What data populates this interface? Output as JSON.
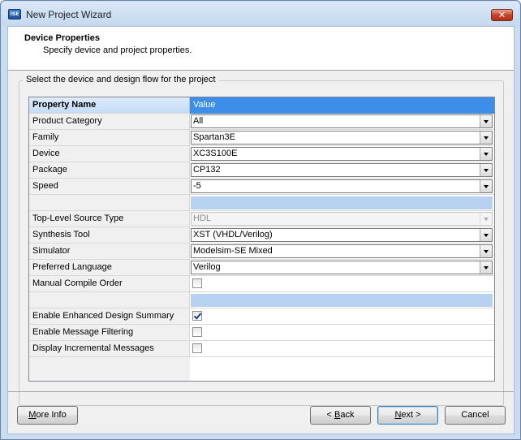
{
  "window": {
    "title": "New Project Wizard",
    "icon": "ise-app-icon",
    "icon_text": "ISE",
    "close_glyph": "✕"
  },
  "header": {
    "title": "Device Properties",
    "subtitle": "Specify device and project properties."
  },
  "group": {
    "caption": "Select the device and design flow for the project"
  },
  "grid": {
    "col_name": "Property Name",
    "col_value": "Value",
    "rows": [
      {
        "name": "Product Category",
        "value": "All",
        "type": "combo"
      },
      {
        "name": "Family",
        "value": "Spartan3E",
        "type": "combo"
      },
      {
        "name": "Device",
        "value": "XC3S100E",
        "type": "combo"
      },
      {
        "name": "Package",
        "value": "CP132",
        "type": "combo"
      },
      {
        "name": "Speed",
        "value": "-5",
        "type": "combo"
      },
      {
        "name": "",
        "value": "",
        "type": "separator"
      },
      {
        "name": "Top-Level Source Type",
        "value": "HDL",
        "type": "combo-disabled"
      },
      {
        "name": "Synthesis Tool",
        "value": "XST (VHDL/Verilog)",
        "type": "combo"
      },
      {
        "name": "Simulator",
        "value": "Modelsim-SE Mixed",
        "type": "combo"
      },
      {
        "name": "Preferred Language",
        "value": "Verilog",
        "type": "combo"
      },
      {
        "name": "Manual Compile Order",
        "value": false,
        "type": "check"
      },
      {
        "name": "",
        "value": "",
        "type": "separator"
      },
      {
        "name": "Enable Enhanced Design Summary",
        "value": true,
        "type": "check"
      },
      {
        "name": "Enable Message Filtering",
        "value": false,
        "type": "check"
      },
      {
        "name": "Display Incremental Messages",
        "value": false,
        "type": "check"
      }
    ]
  },
  "buttons": {
    "more_info": {
      "pre": "",
      "key": "M",
      "post": "ore Info"
    },
    "back": {
      "pre": "< ",
      "key": "B",
      "post": "ack"
    },
    "next": {
      "pre": "",
      "key": "N",
      "post": "ext >"
    },
    "cancel": "Cancel"
  }
}
